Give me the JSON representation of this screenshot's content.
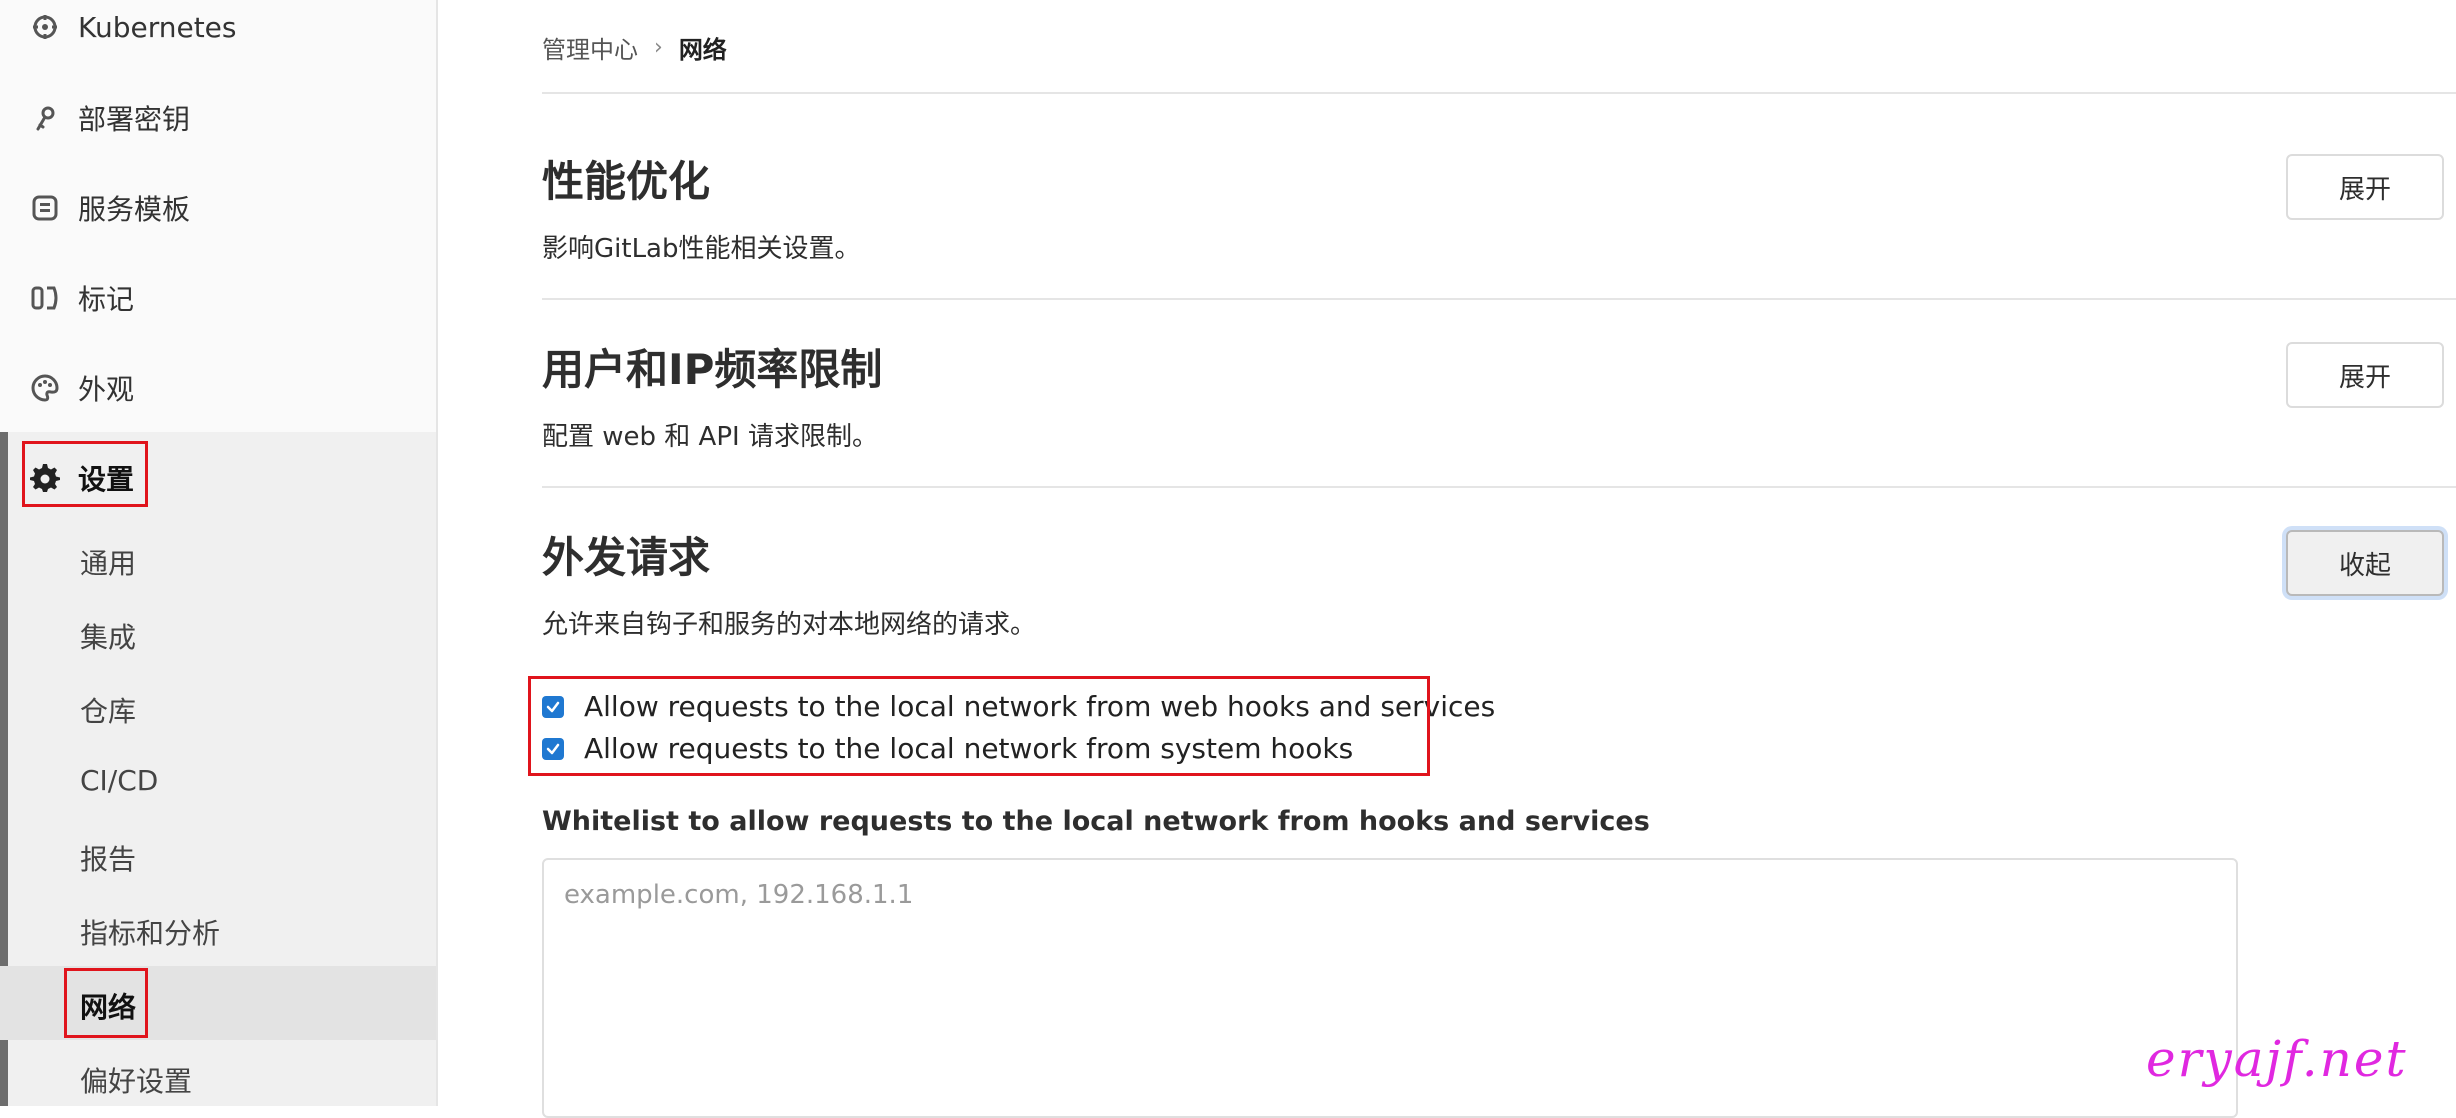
{
  "sidebar": {
    "items": [
      {
        "label": "Kubernetes",
        "icon": "kubernetes-icon"
      },
      {
        "label": "部署密钥",
        "icon": "key-icon"
      },
      {
        "label": "服务模板",
        "icon": "template-icon"
      },
      {
        "label": "标记",
        "icon": "labels-icon"
      },
      {
        "label": "外观",
        "icon": "palette-icon"
      }
    ],
    "settings": {
      "label": "设置",
      "icon": "gear-icon"
    },
    "settings_items": [
      {
        "label": "通用"
      },
      {
        "label": "集成"
      },
      {
        "label": "仓库"
      },
      {
        "label": "CI/CD"
      },
      {
        "label": "报告"
      },
      {
        "label": "指标和分析"
      },
      {
        "label": "网络",
        "active": true
      },
      {
        "label": "偏好设置"
      }
    ]
  },
  "breadcrumb": {
    "parent": "管理中心",
    "separator": "›",
    "current": "网络"
  },
  "sections": [
    {
      "title": "性能优化",
      "description": "影响GitLab性能相关设置。",
      "button": "展开"
    },
    {
      "title": "用户和IP频率限制",
      "description": "配置 web 和 API 请求限制。",
      "button": "展开"
    },
    {
      "title": "外发请求",
      "description": "允许来自钩子和服务的对本地网络的请求。",
      "button": "收起"
    }
  ],
  "outbound": {
    "checkboxes": [
      {
        "label": "Allow requests to the local network from web hooks and services",
        "checked": true
      },
      {
        "label": "Allow requests to the local network from system hooks",
        "checked": true
      }
    ],
    "whitelist_label": "Whitelist to allow requests to the local network from hooks and services",
    "whitelist_value": "",
    "whitelist_placeholder": "example.com, 192.168.1.1"
  },
  "colors": {
    "accent": "#1f78d1",
    "highlight": "#e0141c",
    "watermark": "#e028e0"
  },
  "watermark": "eryajf.net"
}
